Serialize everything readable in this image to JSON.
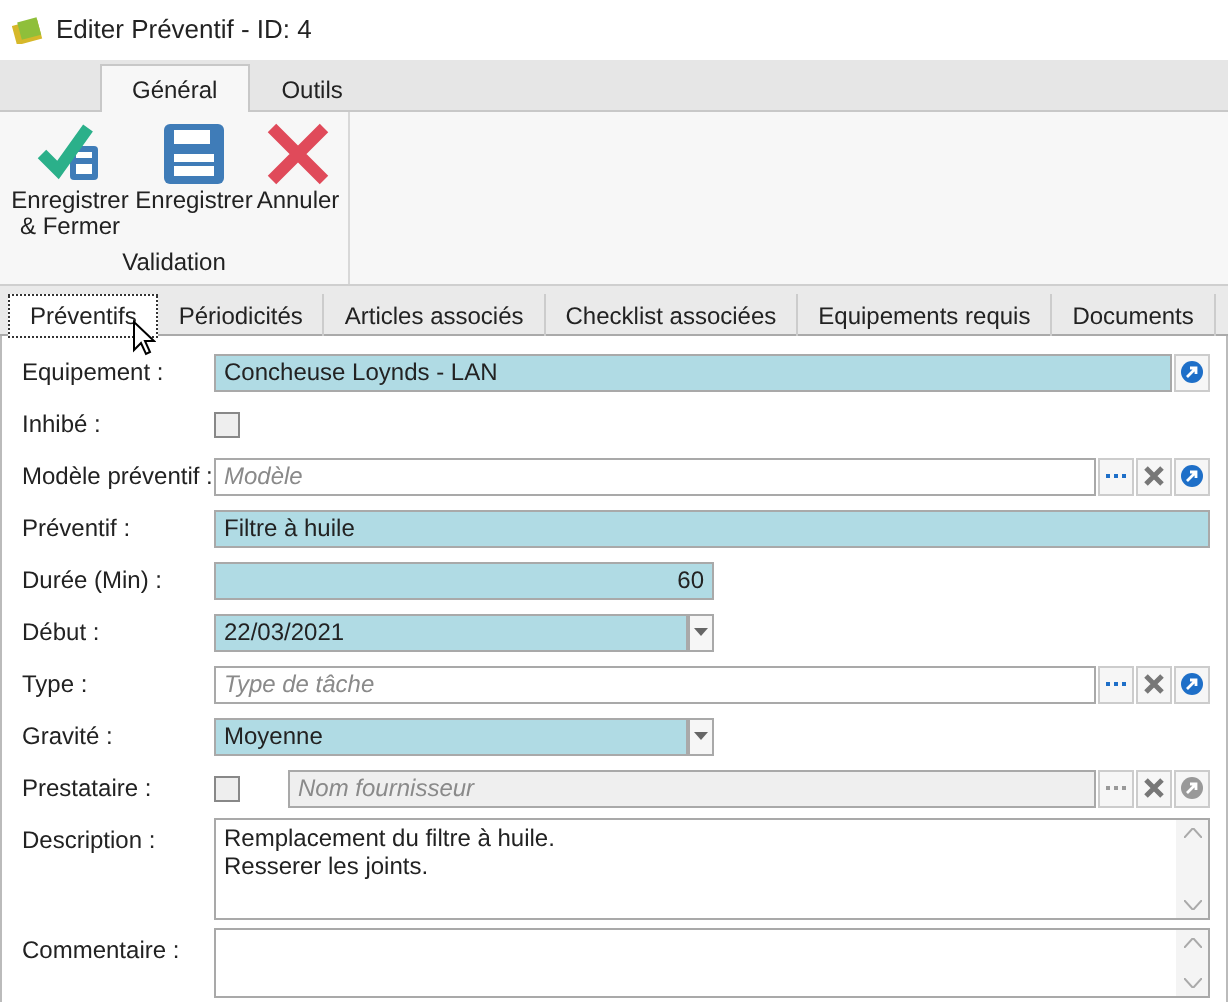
{
  "window": {
    "title": "Editer Préventif - ID: 4"
  },
  "ribbon": {
    "tabs": [
      {
        "label": "Général",
        "selected": true
      },
      {
        "label": "Outils",
        "selected": false
      }
    ],
    "groups": [
      {
        "label": "Validation",
        "buttons": [
          {
            "kind": "save_close",
            "label": "Enregistrer & Fermer"
          },
          {
            "kind": "save",
            "label": "Enregistrer"
          },
          {
            "kind": "cancel",
            "label": "Annuler"
          }
        ]
      }
    ]
  },
  "form_tabs": [
    {
      "label": "Préventifs",
      "selected": true
    },
    {
      "label": "Périodicités",
      "selected": false
    },
    {
      "label": "Articles associés",
      "selected": false
    },
    {
      "label": "Checklist associées",
      "selected": false
    },
    {
      "label": "Equipements requis",
      "selected": false
    },
    {
      "label": "Documents",
      "selected": false
    }
  ],
  "fields": [
    {
      "kind": "picker",
      "label": "Equipement :",
      "value": "Concheuse Loynds - LAN",
      "highlighted": true
    },
    {
      "kind": "checkbox",
      "label": "Inhibé :",
      "checked": false
    },
    {
      "kind": "lookup",
      "label": "Modèle préventif :",
      "placeholder": "Modèle",
      "highlighted": false
    },
    {
      "kind": "text",
      "label": "Préventif :",
      "value": "Filtre à huile",
      "highlighted": true
    },
    {
      "kind": "number",
      "label": "Durée (Min) :",
      "value": "60",
      "highlighted": true
    },
    {
      "kind": "combo",
      "label": "Début :",
      "value": "22/03/2021",
      "highlighted": true
    },
    {
      "kind": "lookup",
      "label": "Type :",
      "placeholder": "Type de tâche",
      "highlighted": false
    },
    {
      "kind": "combo",
      "label": "Gravité :",
      "value": "Moyenne",
      "highlighted": true
    },
    {
      "kind": "supplier",
      "label": "Prestataire :",
      "checked": false,
      "placeholder": "Nom fournisseur",
      "disabled": true
    },
    {
      "kind": "memo",
      "label": "Description :",
      "value": "Remplacement du filtre à huile.\nResserer les joints."
    },
    {
      "kind": "memo",
      "label": "Commentaire :"
    }
  ]
}
